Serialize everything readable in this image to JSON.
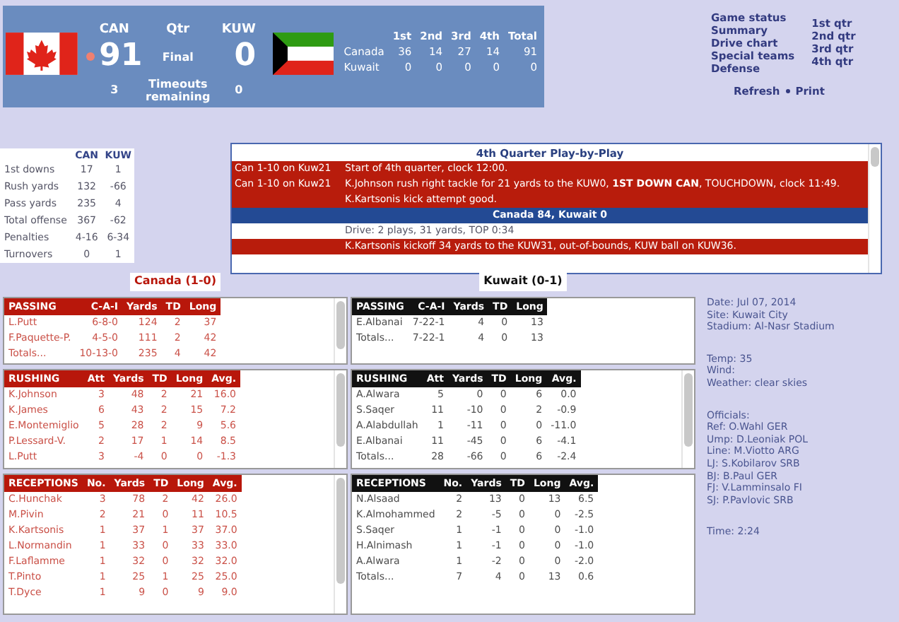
{
  "scoreboard": {
    "teams": [
      {
        "abbr": "CAN",
        "score": "91",
        "timeouts": "3",
        "possession": true
      },
      {
        "abbr": "KUW",
        "score": "0",
        "timeouts": "0",
        "possession": false
      }
    ],
    "qtr_label": "Qtr",
    "period": "Final",
    "timeouts_label": "Timeouts remaining",
    "linescore": {
      "columns": [
        "1st",
        "2nd",
        "3rd",
        "4th",
        "Total"
      ],
      "rows": [
        {
          "team": "Canada",
          "values": [
            "36",
            "14",
            "27",
            "14",
            "91"
          ]
        },
        {
          "team": "Kuwait",
          "values": [
            "0",
            "0",
            "0",
            "0",
            "0"
          ]
        }
      ]
    }
  },
  "nav": {
    "links": [
      "Game status",
      "Summary",
      "Drive chart",
      "Special teams",
      "Defense"
    ],
    "quarters": [
      "1st qtr",
      "2nd qtr",
      "3rd qtr",
      "4th qtr"
    ],
    "actions": [
      "Refresh",
      "Print"
    ]
  },
  "team_stats": {
    "columns": [
      "CAN",
      "KUW"
    ],
    "rows": [
      {
        "label": "1st downs",
        "values": [
          "17",
          "1"
        ]
      },
      {
        "label": "Rush yards",
        "values": [
          "132",
          "-66"
        ]
      },
      {
        "label": "Pass yards",
        "values": [
          "235",
          "4"
        ]
      },
      {
        "label": "Total offense",
        "values": [
          "367",
          "-62"
        ]
      },
      {
        "label": "Penalties",
        "values": [
          "4-16",
          "6-34"
        ]
      },
      {
        "label": "Turnovers",
        "values": [
          "0",
          "1"
        ]
      }
    ]
  },
  "play_by_play": {
    "title": "4th Quarter Play-by-Play",
    "rows": [
      {
        "kind": "play",
        "situation": "Can  1-10 on Kuw21",
        "text": "Start of 4th quarter, clock 12:00."
      },
      {
        "kind": "play",
        "situation": "Can  1-10 on Kuw21",
        "text": "K.Johnson rush right tackle for 21 yards to the KUW0, **1ST DOWN CAN**, TOUCHDOWN, clock 11:49."
      },
      {
        "kind": "play",
        "text": "K.Kartsonis kick attempt good."
      },
      {
        "kind": "score",
        "text": "Canada 84, Kuwait 0"
      },
      {
        "kind": "drive",
        "text": "Drive: 2 plays, 31 yards, TOP 0:34"
      },
      {
        "kind": "play",
        "text": "K.Kartsonis kickoff 34 yards to the KUW31, out-of-bounds, KUW ball on KUW36."
      }
    ]
  },
  "box_score": [
    {
      "name": "Canada (1-0)",
      "color": "#b8170b",
      "sections": [
        {
          "scrollable": true,
          "columns": [
            "PASSING",
            "C-A-I",
            "Yards",
            "TD",
            "Long"
          ],
          "rows": [
            [
              "L.Putt",
              "6-8-0",
              "124",
              "2",
              "37"
            ],
            [
              "F.Paquette-P.",
              "4-5-0",
              "111",
              "2",
              "42"
            ],
            [
              "Totals...",
              "10-13-0",
              "235",
              "4",
              "42"
            ]
          ]
        },
        {
          "scrollable": true,
          "columns": [
            "RUSHING",
            "Att",
            "Yards",
            "TD",
            "Long",
            "Avg."
          ],
          "rows": [
            [
              "K.Johnson",
              "3",
              "48",
              "2",
              "21",
              "16.0"
            ],
            [
              "K.James",
              "6",
              "43",
              "2",
              "15",
              "7.2"
            ],
            [
              "E.Montemiglio",
              "5",
              "28",
              "2",
              "9",
              "5.6"
            ],
            [
              "P.Lessard-V.",
              "2",
              "17",
              "1",
              "14",
              "8.5"
            ],
            [
              "L.Putt",
              "3",
              "-4",
              "0",
              "0",
              "-1.3"
            ]
          ]
        },
        {
          "scrollable": true,
          "columns": [
            "RECEPTIONS",
            "No.",
            "Yards",
            "TD",
            "Long",
            "Avg."
          ],
          "rows": [
            [
              "C.Hunchak",
              "3",
              "78",
              "2",
              "42",
              "26.0"
            ],
            [
              "M.Pivin",
              "2",
              "21",
              "0",
              "11",
              "10.5"
            ],
            [
              "K.Kartsonis",
              "1",
              "37",
              "1",
              "37",
              "37.0"
            ],
            [
              "L.Normandin",
              "1",
              "33",
              "0",
              "33",
              "33.0"
            ],
            [
              "F.Laflamme",
              "1",
              "32",
              "0",
              "32",
              "32.0"
            ],
            [
              "T.Pinto",
              "1",
              "25",
              "1",
              "25",
              "25.0"
            ],
            [
              "T.Dyce",
              "1",
              "9",
              "0",
              "9",
              "9.0"
            ]
          ]
        }
      ]
    },
    {
      "name": "Kuwait (0-1)",
      "color": "#111111",
      "sections": [
        {
          "scrollable": false,
          "columns": [
            "PASSING",
            "C-A-I",
            "Yards",
            "TD",
            "Long"
          ],
          "rows": [
            [
              "E.Albanai",
              "7-22-1",
              "4",
              "0",
              "13"
            ],
            [
              "Totals...",
              "7-22-1",
              "4",
              "0",
              "13"
            ]
          ]
        },
        {
          "scrollable": true,
          "columns": [
            "RUSHING",
            "Att",
            "Yards",
            "TD",
            "Long",
            "Avg."
          ],
          "rows": [
            [
              "A.Alwara",
              "5",
              "0",
              "0",
              "6",
              "0.0"
            ],
            [
              "S.Saqer",
              "11",
              "-10",
              "0",
              "2",
              "-0.9"
            ],
            [
              "A.Alabdullah",
              "1",
              "-11",
              "0",
              "0",
              "-11.0"
            ],
            [
              "E.Albanai",
              "11",
              "-45",
              "0",
              "6",
              "-4.1"
            ],
            [
              "Totals...",
              "28",
              "-66",
              "0",
              "6",
              "-2.4"
            ]
          ]
        },
        {
          "scrollable": false,
          "columns": [
            "RECEPTIONS",
            "No.",
            "Yards",
            "TD",
            "Long",
            "Avg."
          ],
          "rows": [
            [
              "N.Alsaad",
              "2",
              "13",
              "0",
              "13",
              "6.5"
            ],
            [
              "K.Almohammed",
              "2",
              "-5",
              "0",
              "0",
              "-2.5"
            ],
            [
              "S.Saqer",
              "1",
              "-1",
              "0",
              "0",
              "-1.0"
            ],
            [
              "H.Alnimash",
              "1",
              "-1",
              "0",
              "0",
              "-1.0"
            ],
            [
              "A.Alwara",
              "1",
              "-2",
              "0",
              "0",
              "-2.0"
            ],
            [
              "Totals...",
              "7",
              "4",
              "0",
              "13",
              "0.6"
            ]
          ]
        }
      ]
    }
  ],
  "game_info": [
    [
      "Date: Jul 07, 2014",
      "Site: Kuwait City",
      "Stadium: Al-Nasr Stadium"
    ],
    [
      "Temp: 35",
      "Wind:",
      "Weather: clear skies"
    ],
    [
      "Officials:",
      "Ref: O.Wahl GER",
      "Ump: D.Leoniak POL",
      "Line: M.Viotto ARG",
      "LJ: S.Kobilarov SRB",
      "BJ: B.Paul GER",
      "FJ: V.Lamminsalo FI",
      "SJ: P.Pavlovic SRB"
    ],
    [
      "Time: 2:24"
    ]
  ]
}
